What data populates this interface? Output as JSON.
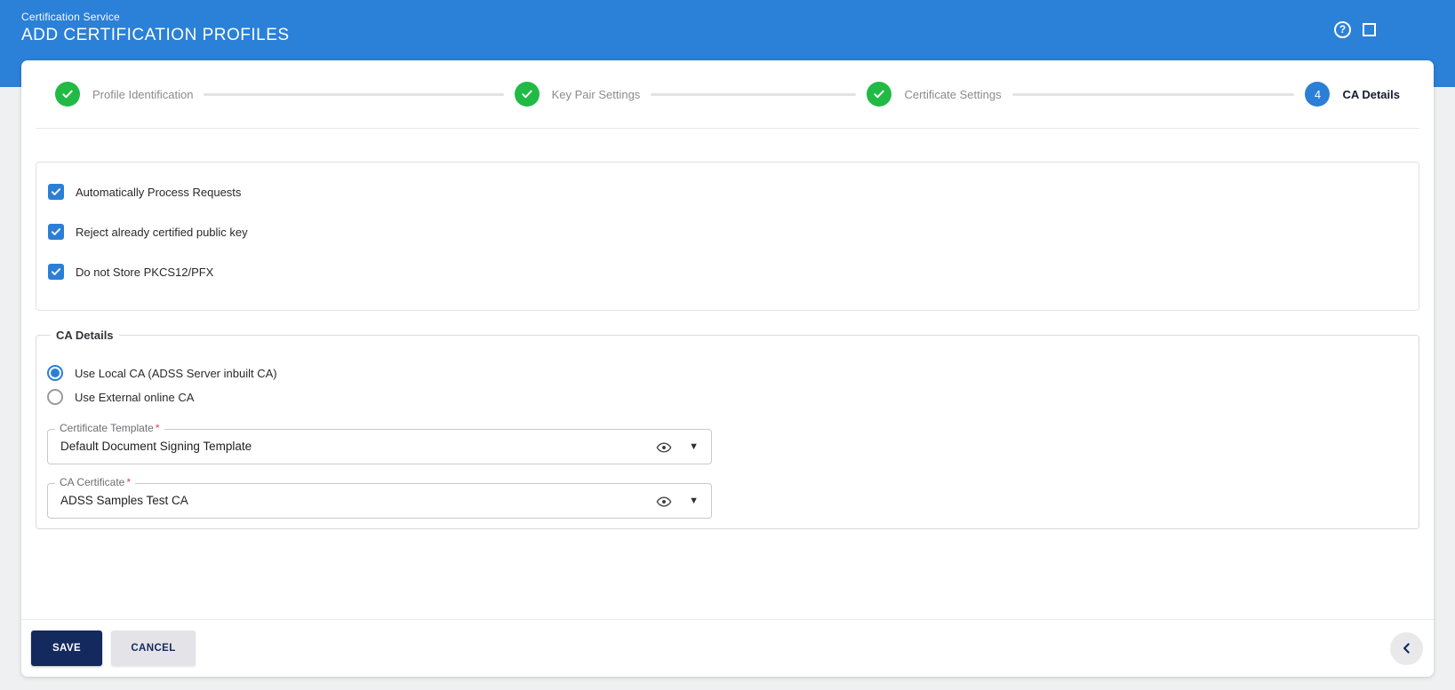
{
  "header": {
    "app_title": "Certification Service",
    "page_title": "ADD CERTIFICATION PROFILES"
  },
  "icons": {
    "help_glyph": "?",
    "dropdown_caret": "▼"
  },
  "stepper": {
    "steps": [
      {
        "label": "Profile Identification",
        "status": "complete"
      },
      {
        "label": "Key Pair Settings",
        "status": "complete"
      },
      {
        "label": "Certificate Settings",
        "status": "complete"
      },
      {
        "label": "CA Details",
        "status": "active",
        "number": "4"
      }
    ]
  },
  "options": {
    "checkboxes": [
      {
        "label": "Automatically Process Requests",
        "checked": true
      },
      {
        "label": "Reject already certified public key",
        "checked": true
      },
      {
        "label": "Do not Store PKCS12/PFX",
        "checked": true
      }
    ]
  },
  "ca_details": {
    "legend": "CA Details",
    "required_mark": "*",
    "radios": [
      {
        "label": "Use Local CA (ADSS Server inbuilt CA)",
        "selected": true
      },
      {
        "label": "Use External online CA",
        "selected": false
      }
    ],
    "fields": [
      {
        "label": "Certificate Template",
        "required": true,
        "value": "Default Document Signing Template"
      },
      {
        "label": "CA Certificate",
        "required": true,
        "value": "ADSS Samples Test CA"
      }
    ]
  },
  "footer": {
    "save_label": "SAVE",
    "cancel_label": "CANCEL"
  },
  "colors": {
    "header_blue": "#2b80d7",
    "accent_blue": "#2b7fd6",
    "success_green": "#21ba45",
    "save_navy": "#14295e",
    "required_red": "#e5453a"
  }
}
